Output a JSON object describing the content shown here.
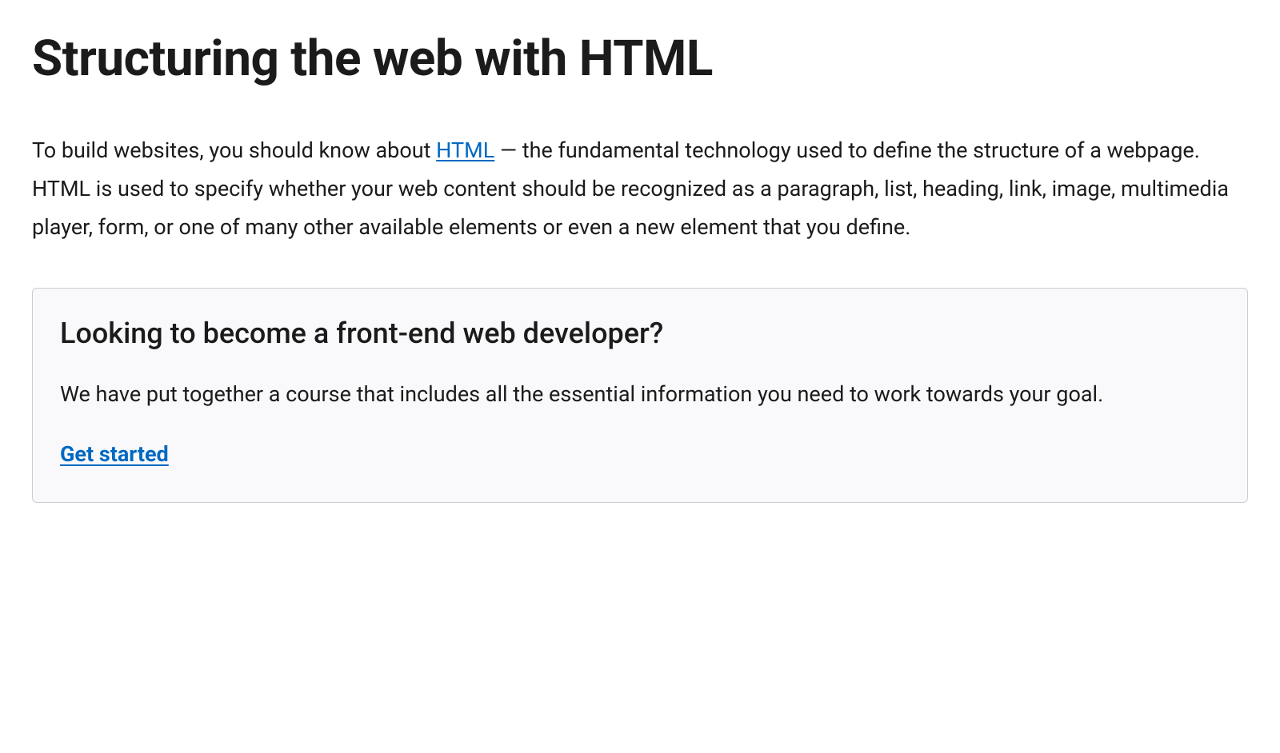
{
  "page": {
    "title": "Structuring the web with HTML",
    "intro": {
      "pre": "To build websites, you should know about ",
      "link_text": "HTML",
      "post": " — the fundamental technology used to define the structure of a webpage. HTML is used to specify whether your web content should be recognized as a paragraph, list, heading, link, image, multimedia player, form, or one of many other available elements or even a new element that you define."
    }
  },
  "callout": {
    "title": "Looking to become a front-end web developer?",
    "body": "We have put together a course that includes all the essential information you need to work towards your goal.",
    "cta": "Get started"
  }
}
